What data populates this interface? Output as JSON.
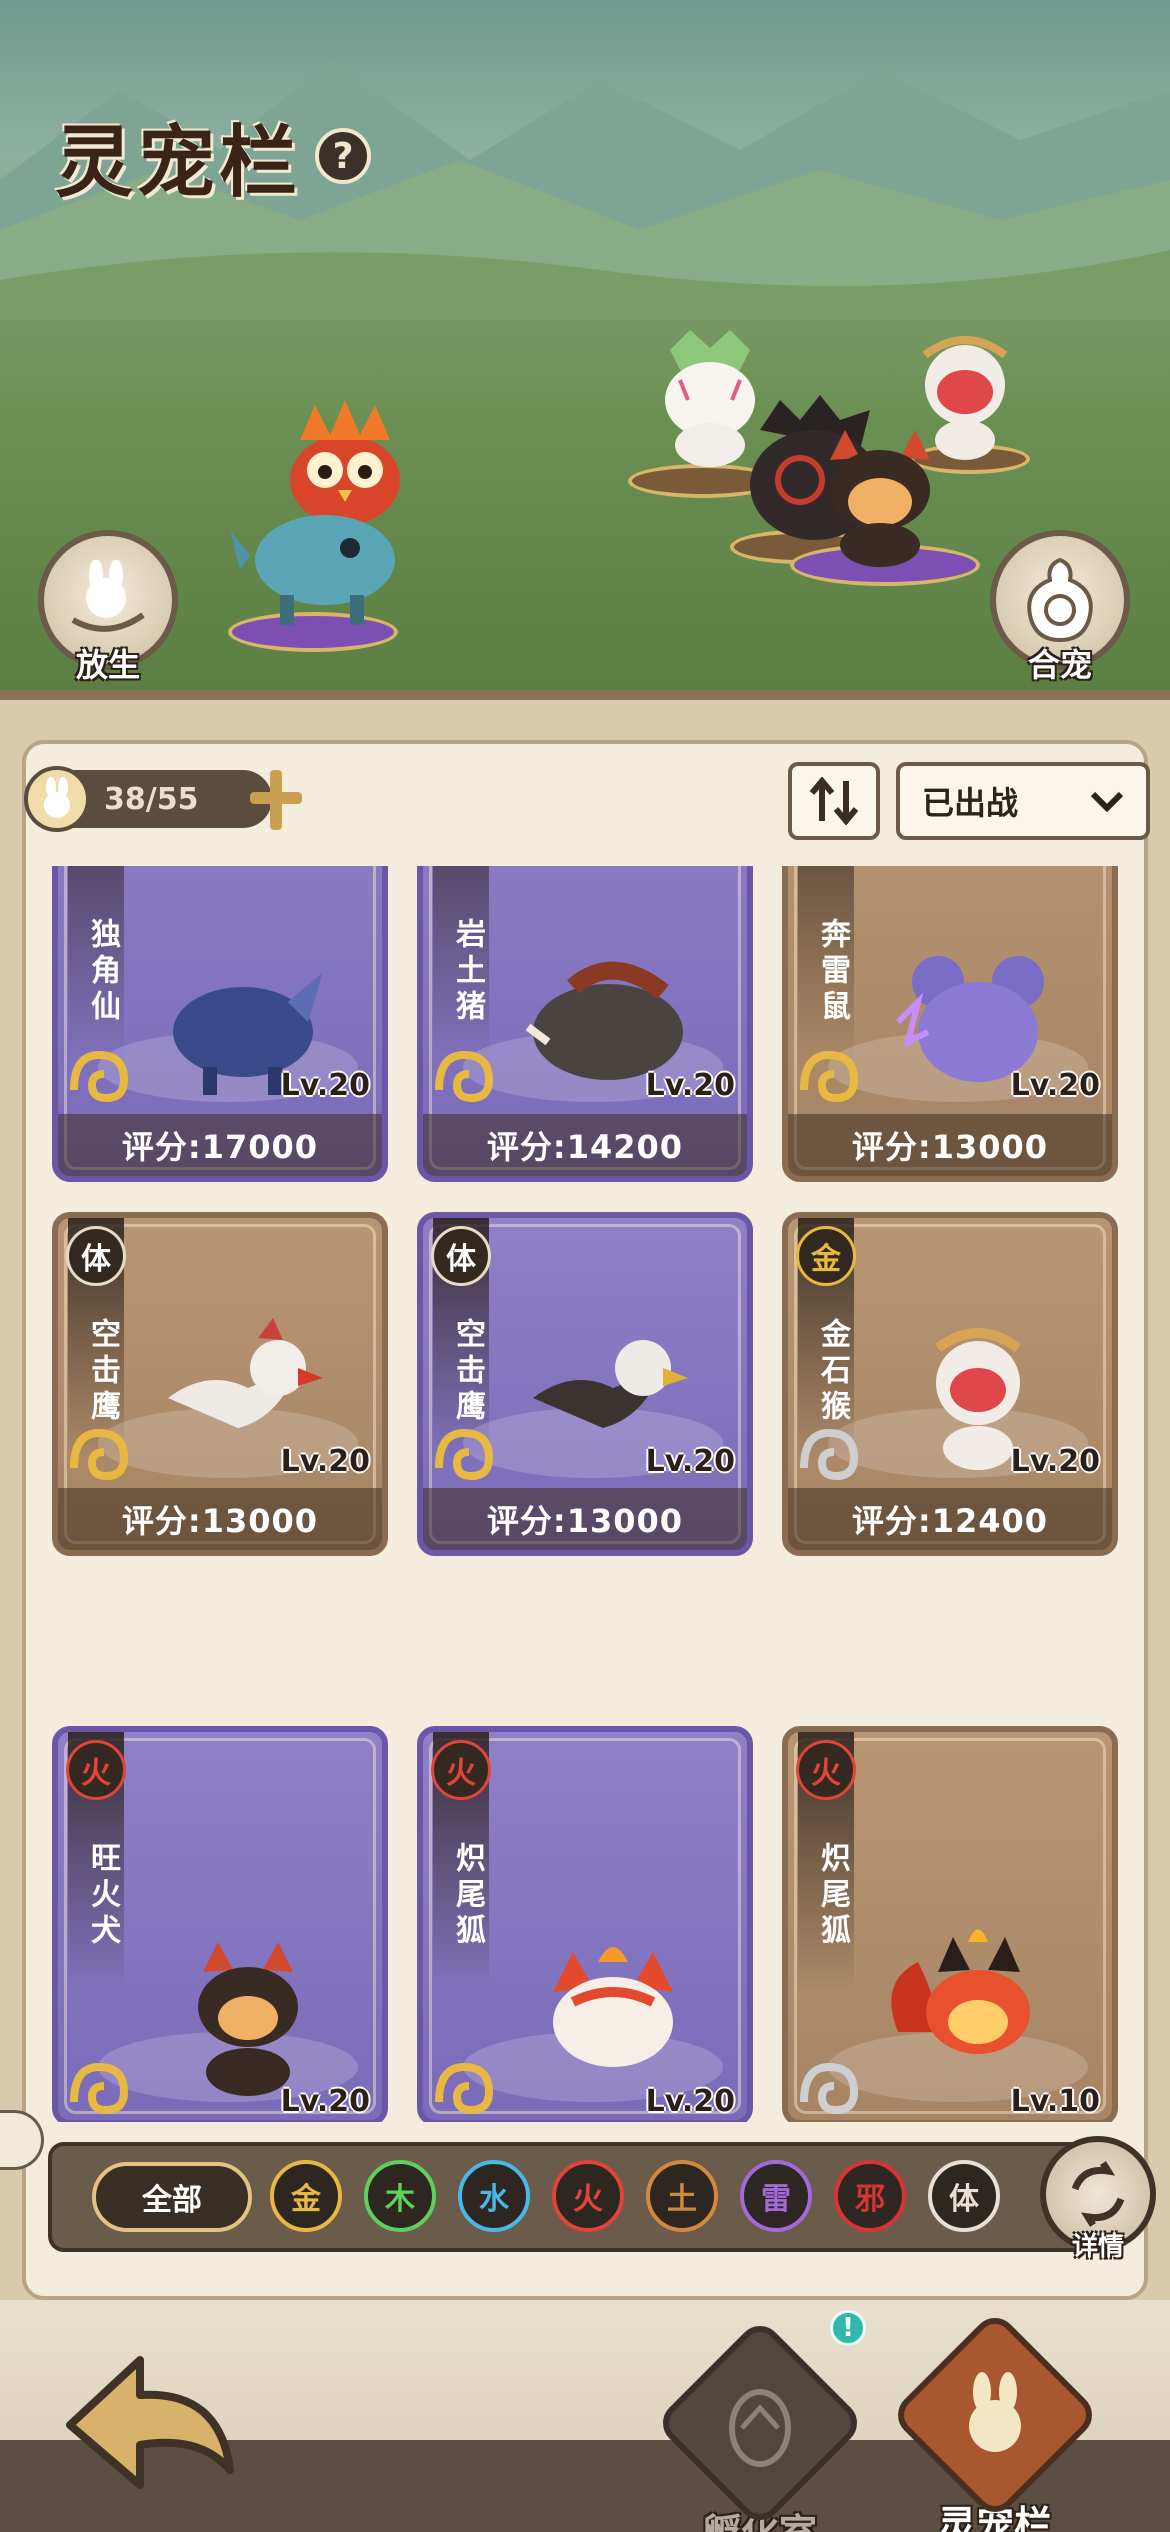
{
  "header": {
    "title": "灵宠栏",
    "help_label": "?"
  },
  "scene_buttons": {
    "release_label": "放生",
    "merge_label": "合宠"
  },
  "inventory": {
    "count": "38/55"
  },
  "filter": {
    "selected": "已出战"
  },
  "cards": [
    {
      "name": "独角仙",
      "element": "",
      "level": "Lv.20",
      "score": "评分:17000",
      "theme": "purple",
      "name_visible": "角仙"
    },
    {
      "name": "岩土猪",
      "element": "",
      "level": "Lv.20",
      "score": "评分:14200",
      "theme": "purple",
      "name_visible": "土猪"
    },
    {
      "name": "奔雷鼠",
      "element": "",
      "level": "Lv.20",
      "score": "评分:13000",
      "theme": "brown",
      "name_visible": "雷鼠"
    },
    {
      "name": "空击鹰",
      "element": "体",
      "level": "Lv.20",
      "score": "评分:13000",
      "theme": "brown",
      "name_visible": "空击鹰"
    },
    {
      "name": "空击鹰",
      "element": "体",
      "level": "Lv.20",
      "score": "评分:13000",
      "theme": "purple",
      "name_visible": "空击鹰"
    },
    {
      "name": "金石猴",
      "element": "金",
      "level": "Lv.20",
      "score": "评分:12400",
      "theme": "brown",
      "name_visible": "金石猴"
    },
    {
      "name": "旺火犬",
      "element": "火",
      "level": "Lv.20",
      "score": "",
      "theme": "purple",
      "name_visible": "旺火犬"
    },
    {
      "name": "炽尾狐",
      "element": "火",
      "level": "Lv.20",
      "score": "",
      "theme": "purple",
      "name_visible": "炽尾狐"
    },
    {
      "name": "炽尾狐",
      "element": "火",
      "level": "Lv.10",
      "score": "",
      "theme": "brown",
      "name_visible": "炽尾狐"
    }
  ],
  "element_filters": {
    "all_label": "全部",
    "chips": [
      {
        "label": "金",
        "color": "#e7b942"
      },
      {
        "label": "木",
        "color": "#5ed15a"
      },
      {
        "label": "水",
        "color": "#46b9e6"
      },
      {
        "label": "火",
        "color": "#e0443a"
      },
      {
        "label": "土",
        "color": "#d08a3c"
      },
      {
        "label": "雷",
        "color": "#a26ad8"
      },
      {
        "label": "邪",
        "color": "#d83434"
      },
      {
        "label": "体",
        "color": "#e8e0d6"
      }
    ],
    "detail_label": "详情"
  },
  "bottom_nav": {
    "hatchery_label": "孵化室",
    "pets_label": "灵宠栏",
    "notice": "!"
  }
}
